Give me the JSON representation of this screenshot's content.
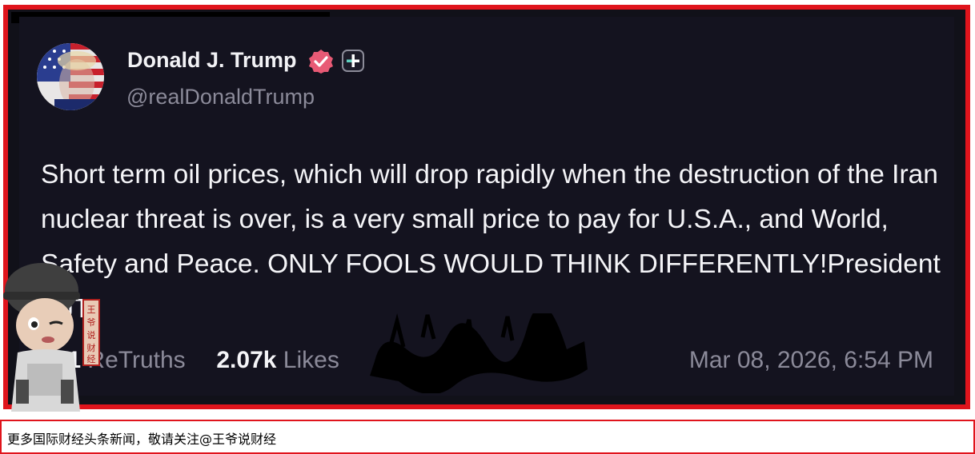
{
  "post": {
    "display_name": "Donald J. Trump",
    "handle": "@realDonaldTrump",
    "verified_icon": "verified-badge-icon",
    "plus_icon": "plus-badge-icon",
    "body": "Short term oil prices, which will drop rapidly when the destruction of the Iran nuclear threat is over, is a very small price to pay for U.S.A., and World, Safety and Peace. ONLY FOOLS WOULD THINK DIFFERENTLY!President DJT",
    "retruths_count": "591",
    "retruths_label": "ReTruths",
    "likes_count": "2.07k",
    "likes_label": "Likes",
    "timestamp": "Mar 08, 2026, 6:54 PM"
  },
  "watermark": {
    "seal_text": "王爷说财经"
  },
  "caption": {
    "text": "更多国际财经头条新闻，敬请关注@王爷说财经"
  },
  "colors": {
    "frame_border": "#e0141c",
    "card_background": "#14131f",
    "primary_text": "#f5f5f8",
    "secondary_text": "#8b8a99",
    "verified_badge": "#e85a75"
  }
}
